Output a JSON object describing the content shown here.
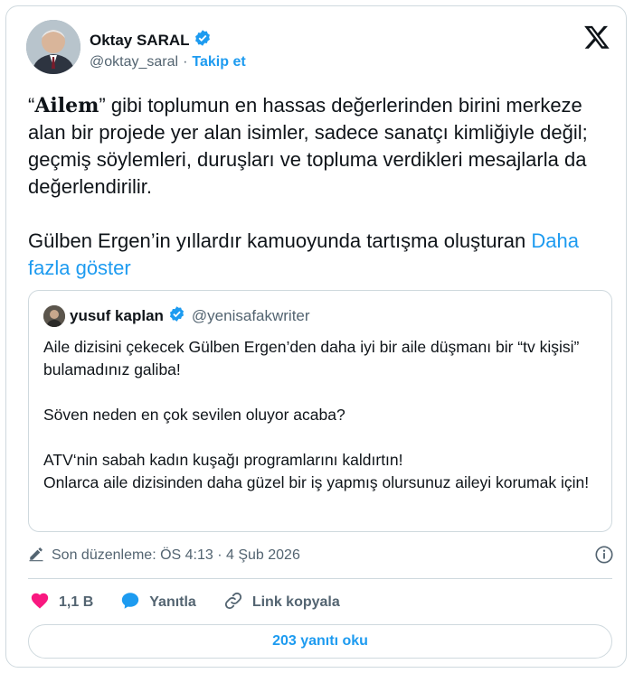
{
  "author": {
    "name": "Oktay SARAL",
    "handle": "@oktay_saral",
    "separator": "·",
    "follow_label": "Takip et"
  },
  "tweet": {
    "open_quote": "“",
    "quoted_word": "Ailem",
    "close_quote_and_text": "” gibi toplumun en hassas değerlerinden birini merkeze alan bir projede yer alan isimler, sadece sanatçı kimliğiyle değil; geçmiş söylemleri, duruşları ve topluma verdikleri mesajlarla da değerlendirilir.",
    "paragraph2": "Gülben Ergen’in yıllardır kamuoyunda tartışma oluşturan",
    "show_more": "Daha fazla göster"
  },
  "quoted_tweet": {
    "name": "yusuf kaplan",
    "handle": "@yenisafakwriter",
    "paragraph1": "Aile dizisini çekecek Gülben Ergen’den daha iyi bir aile düşmanı bir “tv kişisi” bulamadınız galiba!",
    "paragraph2": "Söven neden en çok sevilen oluyor acaba?",
    "paragraph3_line1": "ATV‘nin sabah kadın kuşağı programlarını kaldırtın!",
    "paragraph3_line2": "Onlarca aile dizisinden daha güzel bir iş yapmış olursunuz aileyi korumak için!"
  },
  "meta": {
    "edited_label": "Son düzenleme: ÖS 4:13 · 4 Şub 2026"
  },
  "actions": {
    "likes": "1,1 B",
    "reply_label": "Yanıtla",
    "copy_link_label": "Link kopyala"
  },
  "read_replies_label": "203 yanıtı oku",
  "icons": {
    "like": "heart-icon",
    "reply": "speech-bubble-icon",
    "link": "link-icon",
    "verified": "verified-badge-icon",
    "logo": "x-logo-icon",
    "edit": "pencil-icon",
    "info": "info-icon"
  },
  "colors": {
    "accent": "#1d9bf0",
    "like": "#f91880",
    "text": "#0f1419",
    "secondary": "#536471",
    "border": "#cfd9de"
  }
}
